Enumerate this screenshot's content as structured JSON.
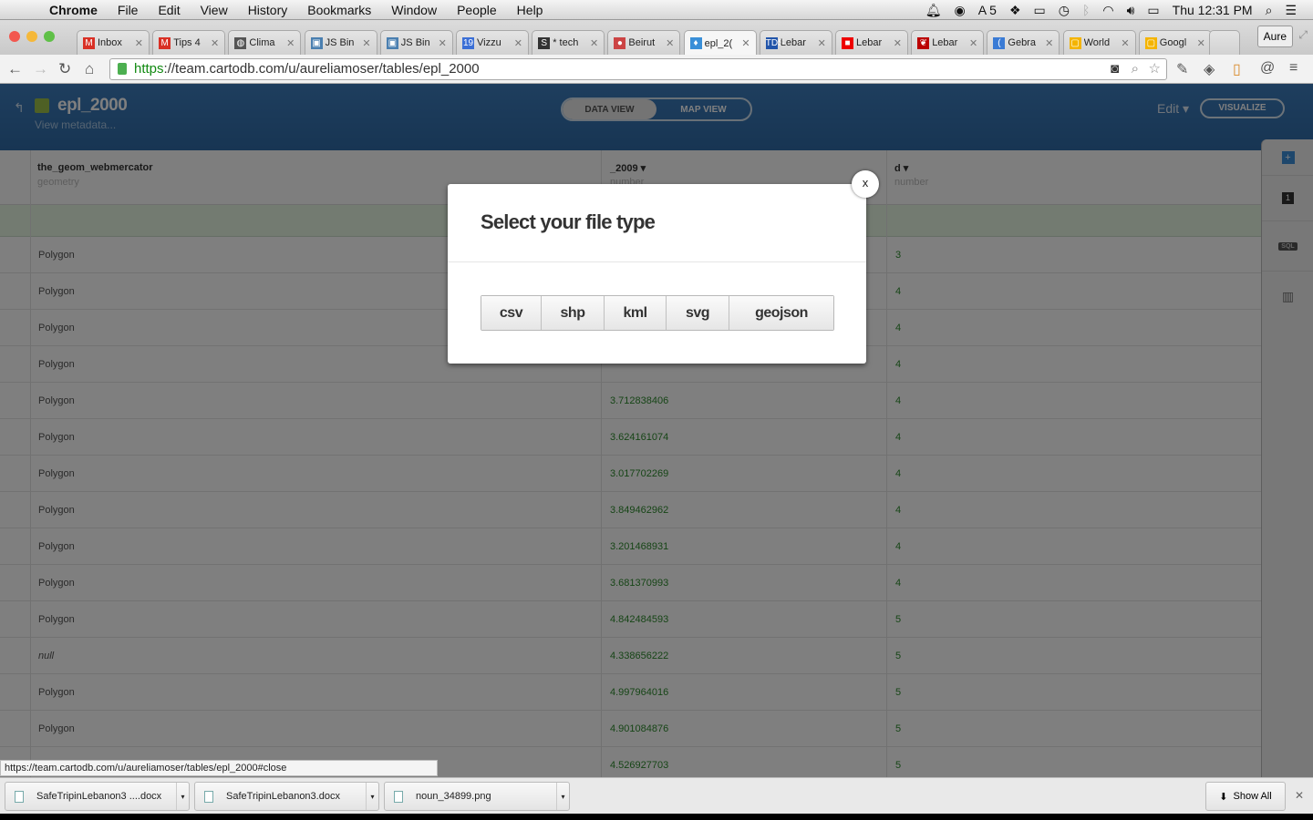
{
  "menubar": {
    "app": "Chrome",
    "items": [
      "File",
      "Edit",
      "View",
      "History",
      "Bookmarks",
      "Window",
      "People",
      "Help"
    ],
    "adobe_count": "5",
    "clock": "Thu 12:31 PM"
  },
  "tabs": [
    {
      "label": "Inbox",
      "color": "#d93025",
      "icon": "M"
    },
    {
      "label": "Tips 4",
      "color": "#d93025",
      "icon": "M"
    },
    {
      "label": "Clima",
      "color": "#555",
      "icon": "◍"
    },
    {
      "label": "JS Bin",
      "color": "#4a7fb0",
      "icon": "▣"
    },
    {
      "label": "JS Bin",
      "color": "#4a7fb0",
      "icon": "▣"
    },
    {
      "label": "Vizzu",
      "color": "#3b6fd6",
      "icon": "19"
    },
    {
      "label": "* tech",
      "color": "#333",
      "icon": "S"
    },
    {
      "label": "Beirut",
      "color": "#c44",
      "icon": "●"
    },
    {
      "label": "epl_2(",
      "color": "#3a8fd8",
      "icon": "♦",
      "active": true
    },
    {
      "label": "Lebar",
      "color": "#2255aa",
      "icon": "TDS"
    },
    {
      "label": "Lebar",
      "color": "#e00",
      "icon": "■"
    },
    {
      "label": "Lebar",
      "color": "#b00",
      "icon": "❦"
    },
    {
      "label": "Gebra",
      "color": "#3a7bd5",
      "icon": "("
    },
    {
      "label": "World",
      "color": "#f4b400",
      "icon": "▢"
    },
    {
      "label": "Googl",
      "color": "#f4b400",
      "icon": "▢"
    }
  ],
  "profile": "Aure",
  "address": {
    "scheme": "https",
    "rest": "://team.cartodb.com/u/aureliamoser/tables/epl_2000"
  },
  "header": {
    "title": "epl_2000",
    "metadata": "View metadata...",
    "data_view": "DATA VIEW",
    "map_view": "MAP VIEW",
    "edit": "Edit",
    "visualize": "VISUALIZE"
  },
  "table": {
    "columns": [
      {
        "name": "the_geom_webmercator",
        "type": "geometry"
      },
      {
        "name": "_2009",
        "type": "number"
      },
      {
        "name": "d",
        "type": "number"
      }
    ],
    "rows": [
      [
        "Polygon",
        "",
        "3"
      ],
      [
        "Polygon",
        "",
        "4"
      ],
      [
        "Polygon",
        "",
        "4"
      ],
      [
        "Polygon",
        "",
        "4"
      ],
      [
        "Polygon",
        "3.712838406",
        "4"
      ],
      [
        "Polygon",
        "3.624161074",
        "4"
      ],
      [
        "Polygon",
        "3.017702269",
        "4"
      ],
      [
        "Polygon",
        "3.849462962",
        "4"
      ],
      [
        "Polygon",
        "3.201468931",
        "4"
      ],
      [
        "Polygon",
        "3.681370993",
        "4"
      ],
      [
        "Polygon",
        "4.842484593",
        "5"
      ],
      [
        "null",
        "4.338656222",
        "5"
      ],
      [
        "Polygon",
        "4.997964016",
        "5"
      ],
      [
        "Polygon",
        "4.901084876",
        "5"
      ],
      [
        "",
        "4.526927703",
        "5"
      ]
    ]
  },
  "sidebar": {
    "layer_number": "1",
    "sql": "SQL"
  },
  "modal": {
    "title": "Select your file type",
    "types": [
      "csv",
      "shp",
      "kml",
      "svg",
      "geojson"
    ],
    "close": "x"
  },
  "status_url": "https://team.cartodb.com/u/aureliamoser/tables/epl_2000#close",
  "downloads": {
    "items": [
      "SafeTripinLebanon3 ....docx",
      "SafeTripinLebanon3.docx",
      "noun_34899.png"
    ],
    "show_all": "Show All"
  }
}
